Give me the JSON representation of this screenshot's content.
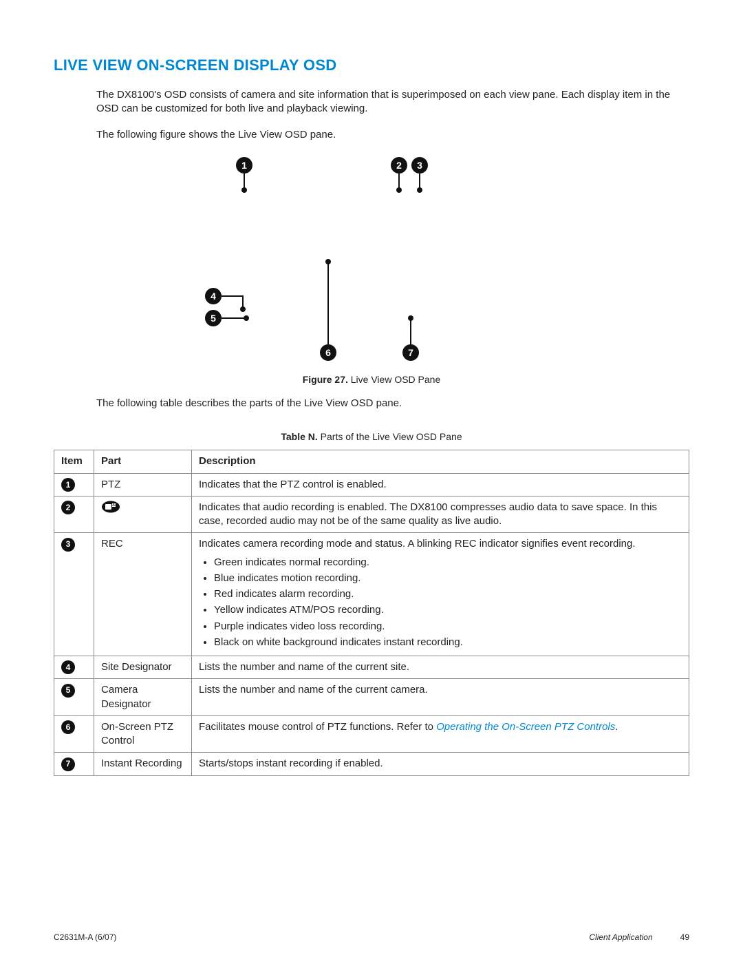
{
  "title": "LIVE VIEW ON-SCREEN DISPLAY OSD",
  "intro": "The DX8100's OSD consists of camera and site information that is superimposed on each view pane. Each display item in the OSD can be customized for both live and playback viewing.",
  "lead_figure": "The following figure shows the Live View OSD pane.",
  "figure_caption_label": "Figure 27.",
  "figure_caption_text": "Live View OSD Pane",
  "lead_table": "The following table describes the parts of the Live View OSD pane.",
  "table_caption_label": "Table N.",
  "table_caption_text": "Parts of the Live View OSD Pane",
  "headers": {
    "item": "Item",
    "part": "Part",
    "desc": "Description"
  },
  "callouts": [
    "1",
    "2",
    "3",
    "4",
    "5",
    "6",
    "7"
  ],
  "rows": [
    {
      "n": "1",
      "part": "PTZ",
      "desc": "Indicates that the PTZ control is enabled."
    },
    {
      "n": "2",
      "part_icon": "audio",
      "desc": "Indicates that audio recording is enabled. The DX8100 compresses audio data to save space. In this case, recorded audio may not be of the same quality as live audio."
    },
    {
      "n": "3",
      "part": "REC",
      "desc": "Indicates camera recording mode and status. A blinking REC indicator signifies event recording.",
      "bullets": [
        "Green indicates normal recording.",
        "Blue indicates motion recording.",
        "Red indicates alarm recording.",
        "Yellow indicates ATM/POS recording.",
        "Purple indicates video loss recording.",
        "Black on white background indicates instant recording."
      ]
    },
    {
      "n": "4",
      "part": "Site Designator",
      "desc": "Lists the number and name of the current site."
    },
    {
      "n": "5",
      "part": "Camera Designator",
      "desc": "Lists the number and name of the current camera."
    },
    {
      "n": "6",
      "part": "On-Screen PTZ Control",
      "desc_prefix": "Facilitates mouse control of PTZ functions. Refer to ",
      "link": "Operating the On-Screen PTZ Controls",
      "desc_suffix": "."
    },
    {
      "n": "7",
      "part": "Instant Recording",
      "desc": "Starts/stops instant recording if enabled."
    }
  ],
  "footer": {
    "left": "C2631M-A (6/07)",
    "app": "Client Application",
    "page": "49"
  }
}
